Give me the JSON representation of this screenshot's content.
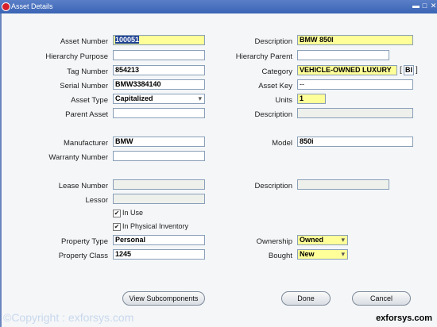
{
  "window": {
    "title": "Asset Details"
  },
  "fields": {
    "asset_number": {
      "label": "Asset Number",
      "value": "100051"
    },
    "description": {
      "label": "Description",
      "value": "BMW 850I"
    },
    "hierarchy_purpose": {
      "label": "Hierarchy Purpose",
      "value": ""
    },
    "hierarchy_parent": {
      "label": "Hierarchy Parent",
      "value": ""
    },
    "tag_number": {
      "label": "Tag Number",
      "value": "854213"
    },
    "category": {
      "label": "Category",
      "value": "VEHICLE-OWNED LUXURY",
      "extra": "BI"
    },
    "serial_number": {
      "label": "Serial Number",
      "value": "BMW3384140"
    },
    "asset_key": {
      "label": "Asset Key",
      "value": "--"
    },
    "asset_type": {
      "label": "Asset Type",
      "value": "Capitalized"
    },
    "units": {
      "label": "Units",
      "value": "1"
    },
    "parent_asset": {
      "label": "Parent Asset",
      "value": ""
    },
    "parent_description": {
      "label": "Description",
      "value": ""
    },
    "manufacturer": {
      "label": "Manufacturer",
      "value": "BMW"
    },
    "model": {
      "label": "Model",
      "value": "850i"
    },
    "warranty_number": {
      "label": "Warranty Number",
      "value": ""
    },
    "lease_number": {
      "label": "Lease Number",
      "value": ""
    },
    "lease_description": {
      "label": "Description",
      "value": ""
    },
    "lessor": {
      "label": "Lessor",
      "value": ""
    },
    "property_type": {
      "label": "Property Type",
      "value": "Personal"
    },
    "ownership": {
      "label": "Ownership",
      "value": "Owned"
    },
    "property_class": {
      "label": "Property Class",
      "value": "1245"
    },
    "bought": {
      "label": "Bought",
      "value": "New"
    }
  },
  "checkboxes": {
    "in_use": {
      "label": "In Use",
      "checked": "✔"
    },
    "in_physical_inventory": {
      "label": "In Physical Inventory",
      "checked": "✔"
    }
  },
  "buttons": {
    "view_subcomponents": "View Subcomponents",
    "done": "Done",
    "cancel": "Cancel"
  },
  "watermarks": {
    "left": "©Copyright : exforsys.com",
    "right": "exforsys.com"
  }
}
